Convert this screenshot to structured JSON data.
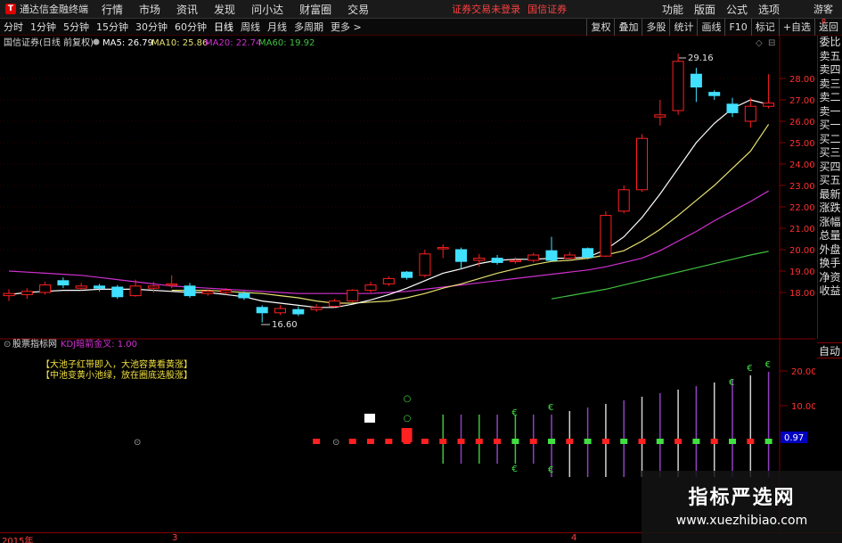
{
  "menubar": {
    "logo": "通达信金融终端",
    "items": [
      "行情",
      "市场",
      "资讯",
      "发现",
      "问小达",
      "财富圈",
      "交易"
    ],
    "warn1": "证券交易未登录",
    "warn2": "国信证券",
    "right_items": [
      "功能",
      "版面",
      "公式",
      "选项"
    ],
    "guest": "游客"
  },
  "periods": [
    "分时",
    "1分钟",
    "5分钟",
    "15分钟",
    "30分钟",
    "60分钟",
    "日线",
    "周线",
    "月线",
    "多周期",
    "更多 >"
  ],
  "active_period": "日线",
  "toolbar": [
    "复权",
    "叠加",
    "多股",
    "统计",
    "画线",
    "F10",
    "标记",
    "+自选",
    "返回"
  ],
  "main_legend": {
    "title": "国信证券(日线 前复权)",
    "ma5": "MA5: 26.79",
    "ma10": "MA10: 25.86",
    "ma20": "MA20: 22.74",
    "ma60": "MA60: 19.92"
  },
  "price_axis": [
    "28.00",
    "27.00",
    "26.00",
    "25.00",
    "24.00",
    "23.00",
    "22.00",
    "21.00",
    "20.00",
    "19.00",
    "18.00"
  ],
  "high_label": "29.16",
  "low_label": "16.60",
  "sub_legend": {
    "title": "股票指标网",
    "indicator": "KDJ暗箭金叉: 1.00"
  },
  "sub_notes": [
    "【大池子红带即入，大池容黄看黄涨】",
    "【中池变黄小池绿，放在圈底选股涨】"
  ],
  "sub_axis": [
    "20.00",
    "10.00"
  ],
  "sub_current": "0.97",
  "side_panel": [
    "委比",
    "卖五",
    "卖四",
    "卖三",
    "卖二",
    "卖一",
    "买一",
    "买二",
    "买三",
    "买四",
    "买五",
    "最新",
    "涨跌",
    "涨幅",
    "总量",
    "外盘",
    "换手",
    "净资",
    "收益"
  ],
  "auto_btn": "自动",
  "dates": [
    "2015年",
    "3",
    "4"
  ],
  "corner": "R",
  "watermark": {
    "title": "指标严选网",
    "url": "www.xuezhibiao.com"
  },
  "colors": {
    "up": "#ff2020",
    "down": "#40e0ff",
    "ma5": "#ffffff",
    "ma10": "#e6e070",
    "ma20": "#d030d0",
    "ma60": "#40c040",
    "frame": "#800000"
  },
  "chart_data": {
    "type": "candlestick",
    "y_range": [
      16.6,
      29.16
    ],
    "candles": [
      {
        "o": 17.85,
        "c": 17.95,
        "h": 18.15,
        "l": 17.6
      },
      {
        "o": 17.9,
        "c": 18.05,
        "h": 18.2,
        "l": 17.7
      },
      {
        "o": 18.0,
        "c": 18.35,
        "h": 18.5,
        "l": 17.9
      },
      {
        "o": 18.55,
        "c": 18.35,
        "h": 18.7,
        "l": 18.2
      },
      {
        "o": 18.2,
        "c": 18.3,
        "h": 18.45,
        "l": 18.1
      },
      {
        "o": 18.3,
        "c": 18.2,
        "h": 18.4,
        "l": 18.05
      },
      {
        "o": 18.25,
        "c": 17.8,
        "h": 18.35,
        "l": 17.7
      },
      {
        "o": 17.85,
        "c": 18.3,
        "h": 18.6,
        "l": 17.8
      },
      {
        "o": 18.2,
        "c": 18.3,
        "h": 18.5,
        "l": 18.0
      },
      {
        "o": 18.35,
        "c": 18.4,
        "h": 18.8,
        "l": 18.2
      },
      {
        "o": 18.3,
        "c": 17.85,
        "h": 18.45,
        "l": 17.75
      },
      {
        "o": 17.95,
        "c": 18.05,
        "h": 18.15,
        "l": 17.85
      },
      {
        "o": 18.0,
        "c": 18.1,
        "h": 18.2,
        "l": 17.9
      },
      {
        "o": 17.95,
        "c": 17.75,
        "h": 18.05,
        "l": 17.65
      },
      {
        "o": 17.3,
        "c": 17.05,
        "h": 17.4,
        "l": 16.6
      },
      {
        "o": 17.05,
        "c": 17.25,
        "h": 17.4,
        "l": 16.95
      },
      {
        "o": 17.2,
        "c": 17.0,
        "h": 17.35,
        "l": 16.9
      },
      {
        "o": 17.2,
        "c": 17.3,
        "h": 17.45,
        "l": 17.1
      },
      {
        "o": 17.35,
        "c": 17.6,
        "h": 17.7,
        "l": 17.3
      },
      {
        "o": 17.6,
        "c": 18.1,
        "h": 18.15,
        "l": 17.55
      },
      {
        "o": 18.1,
        "c": 18.35,
        "h": 18.5,
        "l": 18.0
      },
      {
        "o": 18.4,
        "c": 18.65,
        "h": 18.75,
        "l": 18.3
      },
      {
        "o": 18.95,
        "c": 18.7,
        "h": 19.0,
        "l": 18.6
      },
      {
        "o": 18.8,
        "c": 19.8,
        "h": 20.0,
        "l": 18.7
      },
      {
        "o": 20.05,
        "c": 20.1,
        "h": 20.25,
        "l": 19.6
      },
      {
        "o": 20.0,
        "c": 19.45,
        "h": 20.1,
        "l": 19.1
      },
      {
        "o": 19.5,
        "c": 19.6,
        "h": 19.8,
        "l": 19.2
      },
      {
        "o": 19.6,
        "c": 19.4,
        "h": 19.75,
        "l": 19.3
      },
      {
        "o": 19.45,
        "c": 19.5,
        "h": 19.65,
        "l": 19.35
      },
      {
        "o": 19.5,
        "c": 19.75,
        "h": 19.85,
        "l": 19.4
      },
      {
        "o": 19.95,
        "c": 19.5,
        "h": 20.6,
        "l": 19.45
      },
      {
        "o": 19.6,
        "c": 19.75,
        "h": 19.9,
        "l": 19.5
      },
      {
        "o": 20.05,
        "c": 19.65,
        "h": 20.1,
        "l": 19.55
      },
      {
        "o": 19.7,
        "c": 21.6,
        "h": 21.8,
        "l": 19.65
      },
      {
        "o": 21.8,
        "c": 22.8,
        "h": 23.0,
        "l": 21.7
      },
      {
        "o": 22.8,
        "c": 25.2,
        "h": 25.4,
        "l": 22.7
      },
      {
        "o": 26.2,
        "c": 26.3,
        "h": 27.0,
        "l": 25.8
      },
      {
        "o": 26.5,
        "c": 28.8,
        "h": 29.16,
        "l": 26.3
      },
      {
        "o": 28.2,
        "c": 27.6,
        "h": 28.5,
        "l": 26.9
      },
      {
        "o": 27.35,
        "c": 27.2,
        "h": 27.45,
        "l": 27.0
      },
      {
        "o": 26.8,
        "c": 26.4,
        "h": 27.1,
        "l": 26.2
      },
      {
        "o": 26.0,
        "c": 26.7,
        "h": 27.1,
        "l": 25.7
      },
      {
        "o": 26.7,
        "c": 26.85,
        "h": 28.2,
        "l": 26.6
      }
    ],
    "ma5": [
      17.9,
      18.0,
      18.05,
      18.1,
      18.1,
      18.15,
      18.15,
      18.15,
      18.1,
      18.05,
      18.0,
      18.0,
      17.9,
      17.8,
      17.6,
      17.5,
      17.4,
      17.3,
      17.3,
      17.45,
      17.65,
      17.9,
      18.2,
      18.55,
      18.9,
      19.1,
      19.35,
      19.5,
      19.55,
      19.55,
      19.6,
      19.6,
      19.65,
      20.0,
      20.6,
      21.5,
      22.6,
      23.8,
      25.0,
      25.9,
      26.6,
      27.0,
      26.79
    ],
    "ma10": [
      null,
      null,
      null,
      null,
      null,
      null,
      null,
      null,
      null,
      18.1,
      18.1,
      18.1,
      18.05,
      18.0,
      17.95,
      17.85,
      17.75,
      17.6,
      17.5,
      17.5,
      17.55,
      17.6,
      17.75,
      17.95,
      18.2,
      18.4,
      18.65,
      18.9,
      19.1,
      19.3,
      19.45,
      19.5,
      19.6,
      19.75,
      19.95,
      20.4,
      20.95,
      21.6,
      22.3,
      23.0,
      23.8,
      24.6,
      25.86
    ],
    "ma20": [
      19.0,
      18.95,
      18.9,
      18.85,
      18.8,
      18.7,
      18.6,
      18.5,
      18.4,
      18.3,
      18.25,
      18.2,
      18.15,
      18.1,
      18.05,
      18.0,
      17.95,
      17.95,
      17.95,
      17.95,
      17.95,
      18.0,
      18.05,
      18.15,
      18.25,
      18.35,
      18.45,
      18.55,
      18.65,
      18.75,
      18.85,
      18.95,
      19.05,
      19.2,
      19.4,
      19.6,
      19.95,
      20.4,
      20.85,
      21.35,
      21.8,
      22.25,
      22.74
    ],
    "ma60_from_index": 30,
    "ma60": [
      17.7,
      17.85,
      18.0,
      18.15,
      18.35,
      18.55,
      18.75,
      18.95,
      19.15,
      19.35,
      19.55,
      19.75,
      19.92
    ],
    "sub_signals": {
      "squares": [
        17,
        19,
        20,
        21,
        22,
        23,
        24,
        25,
        26,
        27,
        28,
        29,
        30,
        31,
        32,
        33,
        34,
        35,
        36,
        37,
        38,
        39,
        40,
        41,
        42
      ],
      "green_bars_from": 28,
      "tall_from": 30
    }
  }
}
